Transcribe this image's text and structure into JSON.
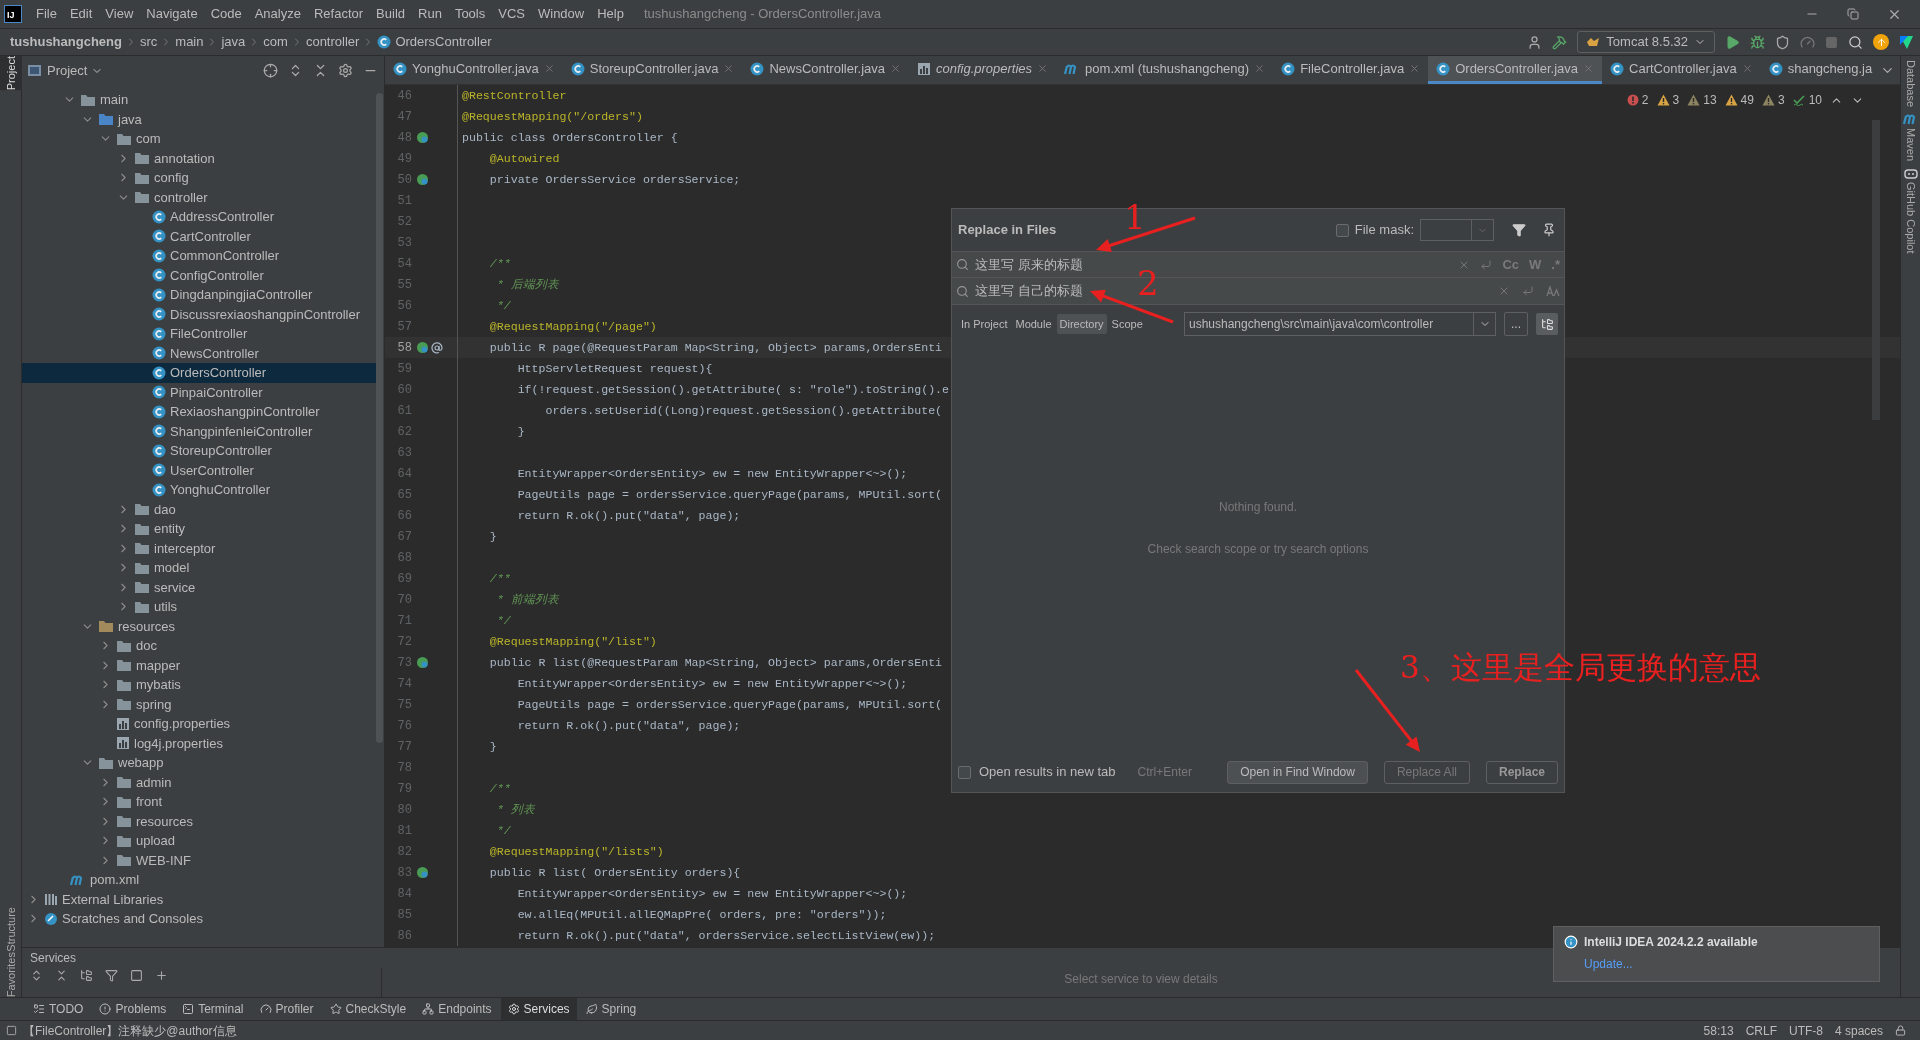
{
  "menu_bar": {
    "logo_text": "IJ",
    "items": [
      "File",
      "Edit",
      "View",
      "Navigate",
      "Code",
      "Analyze",
      "Refactor",
      "Build",
      "Run",
      "Tools",
      "VCS",
      "Window",
      "Help"
    ],
    "title": "tushushangcheng - OrdersController.java"
  },
  "nav_bar": {
    "breadcrumbs": [
      {
        "label": "tushushangcheng",
        "kind": "project"
      },
      {
        "label": "src",
        "kind": "dir"
      },
      {
        "label": "main",
        "kind": "dir"
      },
      {
        "label": "java",
        "kind": "dir"
      },
      {
        "label": "com",
        "kind": "dir"
      },
      {
        "label": "controller",
        "kind": "dir"
      },
      {
        "label": "OrdersController",
        "kind": "class"
      }
    ],
    "run_config": "Tomcat 8.5.32"
  },
  "left_stripe": [
    {
      "label": "Project",
      "selected": true
    },
    {
      "label": "Structure",
      "selected": false
    },
    {
      "label": "Favorites",
      "selected": false
    }
  ],
  "right_stripe": [
    {
      "label": "Database",
      "kind": "database"
    },
    {
      "label": "Maven",
      "kind": "maven"
    },
    {
      "label": "GitHub Copilot",
      "kind": "copilot"
    }
  ],
  "project_panel": {
    "title": "Project",
    "tree": [
      {
        "label": "main",
        "kind": "folder",
        "expanded": true,
        "selected": false,
        "children": [
          {
            "label": "java",
            "kind": "source-folder",
            "expanded": true,
            "selected": false,
            "children": [
              {
                "label": "com",
                "kind": "folder",
                "expanded": true,
                "selected": false,
                "children": [
                  {
                    "label": "annotation",
                    "kind": "folder",
                    "expanded": false,
                    "selected": false
                  },
                  {
                    "label": "config",
                    "kind": "folder",
                    "expanded": false,
                    "selected": false
                  },
                  {
                    "label": "controller",
                    "kind": "folder",
                    "expanded": true,
                    "selected": false,
                    "children": [
                      {
                        "label": "AddressController",
                        "kind": "class",
                        "selected": false
                      },
                      {
                        "label": "CartController",
                        "kind": "class",
                        "selected": false
                      },
                      {
                        "label": "CommonController",
                        "kind": "class",
                        "selected": false
                      },
                      {
                        "label": "ConfigController",
                        "kind": "class",
                        "selected": false
                      },
                      {
                        "label": "DingdanpingjiaController",
                        "kind": "class",
                        "selected": false
                      },
                      {
                        "label": "DiscussrexiaoshangpinController",
                        "kind": "class",
                        "selected": false
                      },
                      {
                        "label": "FileController",
                        "kind": "class",
                        "selected": false
                      },
                      {
                        "label": "NewsController",
                        "kind": "class",
                        "selected": false
                      },
                      {
                        "label": "OrdersController",
                        "kind": "class",
                        "selected": true
                      },
                      {
                        "label": "PinpaiController",
                        "kind": "class",
                        "selected": false
                      },
                      {
                        "label": "RexiaoshangpinController",
                        "kind": "class",
                        "selected": false
                      },
                      {
                        "label": "ShangpinfenleiController",
                        "kind": "class",
                        "selected": false
                      },
                      {
                        "label": "StoreupController",
                        "kind": "class",
                        "selected": false
                      },
                      {
                        "label": "UserController",
                        "kind": "class",
                        "selected": false
                      },
                      {
                        "label": "YonghuController",
                        "kind": "class",
                        "selected": false
                      }
                    ]
                  },
                  {
                    "label": "dao",
                    "kind": "folder",
                    "expanded": false,
                    "selected": false
                  },
                  {
                    "label": "entity",
                    "kind": "folder",
                    "expanded": false,
                    "selected": false
                  },
                  {
                    "label": "interceptor",
                    "kind": "folder",
                    "expanded": false,
                    "selected": false
                  },
                  {
                    "label": "model",
                    "kind": "folder",
                    "expanded": false,
                    "selected": false
                  },
                  {
                    "label": "service",
                    "kind": "folder",
                    "expanded": false,
                    "selected": false
                  },
                  {
                    "label": "utils",
                    "kind": "folder",
                    "expanded": false,
                    "selected": false
                  }
                ]
              }
            ]
          },
          {
            "label": "resources",
            "kind": "resources-folder",
            "expanded": true,
            "selected": false,
            "children": [
              {
                "label": "doc",
                "kind": "folder",
                "expanded": false,
                "selected": false
              },
              {
                "label": "mapper",
                "kind": "folder",
                "expanded": false,
                "selected": false
              },
              {
                "label": "mybatis",
                "kind": "folder",
                "expanded": false,
                "selected": false
              },
              {
                "label": "spring",
                "kind": "folder",
                "expanded": false,
                "selected": false
              },
              {
                "label": "config.properties",
                "kind": "properties",
                "selected": false
              },
              {
                "label": "log4j.properties",
                "kind": "properties",
                "selected": false
              }
            ]
          },
          {
            "label": "webapp",
            "kind": "folder",
            "expanded": true,
            "selected": false,
            "children": [
              {
                "label": "admin",
                "kind": "folder",
                "expanded": false,
                "selected": false
              },
              {
                "label": "front",
                "kind": "folder",
                "expanded": false,
                "selected": false
              },
              {
                "label": "resources",
                "kind": "folder",
                "expanded": false,
                "selected": false
              },
              {
                "label": "upload",
                "kind": "folder",
                "expanded": false,
                "selected": false
              },
              {
                "label": "WEB-INF",
                "kind": "folder",
                "expanded": false,
                "selected": false
              }
            ]
          }
        ]
      },
      {
        "label": "pom.xml",
        "kind": "maven",
        "selected": false
      },
      {
        "label": "External Libraries",
        "kind": "library",
        "expanded": false,
        "selected": false
      },
      {
        "label": "Scratches and Consoles",
        "kind": "scratches",
        "expanded": false,
        "selected": false
      }
    ]
  },
  "editor_tabs": [
    {
      "label": "YonghuController.java",
      "kind": "class",
      "selected": false
    },
    {
      "label": "StoreupController.java",
      "kind": "class",
      "selected": false
    },
    {
      "label": "NewsController.java",
      "kind": "class",
      "selected": false
    },
    {
      "label": "config.properties",
      "kind": "properties",
      "selected": false
    },
    {
      "label": "pom.xml (tushushangcheng)",
      "kind": "maven",
      "selected": false
    },
    {
      "label": "FileController.java",
      "kind": "class",
      "selected": false
    },
    {
      "label": "OrdersController.java",
      "kind": "class",
      "selected": true
    },
    {
      "label": "CartController.java",
      "kind": "class",
      "selected": false
    },
    {
      "label": "shangcheng.ja",
      "kind": "class",
      "selected": false
    }
  ],
  "inspections": [
    {
      "kind": "error",
      "count": "2"
    },
    {
      "kind": "warning",
      "count": "3"
    },
    {
      "kind": "weak",
      "count": "13"
    },
    {
      "kind": "warning",
      "count": "49"
    },
    {
      "kind": "weak",
      "count": "3"
    },
    {
      "kind": "typo",
      "count": "10"
    }
  ],
  "code_lines": [
    {
      "no": "46",
      "kind": "annotation",
      "text": "@RestController",
      "current": false
    },
    {
      "no": "47",
      "kind": "annotation",
      "text": "@RequestMapping(\"/orders\")",
      "current": false
    },
    {
      "no": "48",
      "kind": "code",
      "text": "public class OrdersController {",
      "current": false,
      "gutter_icon": {
        "kind": "bean"
      }
    },
    {
      "no": "49",
      "kind": "annotation",
      "text": "    @Autowired",
      "current": false
    },
    {
      "no": "50",
      "kind": "code",
      "text": "    private OrdersService ordersService;",
      "current": false,
      "gutter_icon": {
        "kind": "bean"
      }
    },
    {
      "no": "51",
      "kind": "blank",
      "current": false
    },
    {
      "no": "52",
      "kind": "blank",
      "current": false
    },
    {
      "no": "53",
      "kind": "blank",
      "current": false
    },
    {
      "no": "54",
      "kind": "comment",
      "text": "    /**",
      "current": false
    },
    {
      "no": "55",
      "kind": "comment",
      "text": "     * 后端列表",
      "current": false
    },
    {
      "no": "56",
      "kind": "comment",
      "text": "     */",
      "current": false
    },
    {
      "no": "57",
      "kind": "annotation",
      "text": "    @RequestMapping(\"/page\")",
      "current": false
    },
    {
      "no": "58",
      "kind": "code",
      "text": "    public R page(@RequestParam Map<String, Object> params,OrdersEnti",
      "current": true,
      "gutter_icon": {
        "kind": "bean-at"
      }
    },
    {
      "no": "59",
      "kind": "code",
      "text": "        HttpServletRequest request){",
      "current": false
    },
    {
      "no": "60",
      "kind": "code",
      "text": "        if(!request.getSession().getAttribute( s: \"role\").toString().e",
      "current": false
    },
    {
      "no": "61",
      "kind": "code",
      "text": "            orders.setUserid((Long)request.getSession().getAttribute(",
      "current": false
    },
    {
      "no": "62",
      "kind": "code",
      "text": "        }",
      "current": false
    },
    {
      "no": "63",
      "kind": "blank",
      "current": false
    },
    {
      "no": "64",
      "kind": "code",
      "text": "        EntityWrapper<OrdersEntity> ew = new EntityWrapper<~>();",
      "current": false
    },
    {
      "no": "65",
      "kind": "code",
      "text": "        PageUtils page = ordersService.queryPage(params, MPUtil.sort(",
      "current": false
    },
    {
      "no": "66",
      "kind": "code",
      "text": "        return R.ok().put(\"data\", page);",
      "current": false
    },
    {
      "no": "67",
      "kind": "code",
      "text": "    }",
      "current": false
    },
    {
      "no": "68",
      "kind": "blank",
      "current": false
    },
    {
      "no": "69",
      "kind": "comment",
      "text": "    /**",
      "current": false
    },
    {
      "no": "70",
      "kind": "comment",
      "text": "     * 前端列表",
      "current": false
    },
    {
      "no": "71",
      "kind": "comment",
      "text": "     */",
      "current": false
    },
    {
      "no": "72",
      "kind": "annotation",
      "text": "    @RequestMapping(\"/list\")",
      "current": false
    },
    {
      "no": "73",
      "kind": "code",
      "text": "    public R list(@RequestParam Map<String, Object> params,OrdersEnti",
      "current": false,
      "gutter_icon": {
        "kind": "bean"
      }
    },
    {
      "no": "74",
      "kind": "code",
      "text": "        EntityWrapper<OrdersEntity> ew = new EntityWrapper<~>();",
      "current": false
    },
    {
      "no": "75",
      "kind": "code",
      "text": "        PageUtils page = ordersService.queryPage(params, MPUtil.sort(",
      "current": false
    },
    {
      "no": "76",
      "kind": "code",
      "text": "        return R.ok().put(\"data\", page);",
      "current": false
    },
    {
      "no": "77",
      "kind": "code",
      "text": "    }",
      "current": false
    },
    {
      "no": "78",
      "kind": "blank",
      "current": false
    },
    {
      "no": "79",
      "kind": "comment",
      "text": "    /**",
      "current": false
    },
    {
      "no": "80",
      "kind": "comment",
      "text": "     * 列表",
      "current": false
    },
    {
      "no": "81",
      "kind": "comment",
      "text": "     */",
      "current": false
    },
    {
      "no": "82",
      "kind": "annotation",
      "text": "    @RequestMapping(\"/lists\")",
      "current": false
    },
    {
      "no": "83",
      "kind": "code",
      "text": "    public R list( OrdersEntity orders){",
      "current": false,
      "gutter_icon": {
        "kind": "bean"
      }
    },
    {
      "no": "84",
      "kind": "code",
      "text": "        EntityWrapper<OrdersEntity> ew = new EntityWrapper<~>();",
      "current": false
    },
    {
      "no": "85",
      "kind": "code",
      "text": "        ew.allEq(MPUtil.allEQMapPre( orders, pre: \"orders\"));",
      "current": false
    },
    {
      "no": "86",
      "kind": "code",
      "text": "        return R.ok().put(\"data\", ordersService.selectListView(ew));",
      "current": false
    }
  ],
  "replace_dialog": {
    "title": "Replace in Files",
    "file_mask": {
      "label": "File mask:",
      "checked": false
    },
    "search_text": "这里写 原来的标题",
    "replace_text": "这里写 自己的标题",
    "search_options": [
      "Cc",
      "W",
      ".*"
    ],
    "scopes": [
      {
        "label": "In Project",
        "selected": false
      },
      {
        "label": "Module",
        "selected": false
      },
      {
        "label": "Directory",
        "selected": true
      },
      {
        "label": "Scope",
        "selected": false
      }
    ],
    "directory": "ushushangcheng\\src\\main\\java\\com\\controller",
    "browse": "...",
    "empty_title": "Nothing found.",
    "empty_hint": "Check search scope or try search options",
    "open_in_new_tab": {
      "label": "Open results in new tab",
      "checked": false
    },
    "shortcut": "Ctrl+Enter",
    "buttons": [
      {
        "label": "Open in Find Window",
        "disabled": false
      },
      {
        "label": "Replace All",
        "disabled": true
      },
      {
        "label": "Replace",
        "disabled": false
      }
    ]
  },
  "annotations": [
    {
      "kind": "number",
      "text": "1"
    },
    {
      "kind": "number",
      "text": "2"
    },
    {
      "kind": "note",
      "text": "3、这里是全局更换的意思"
    }
  ],
  "services": {
    "title": "Services",
    "empty": "Select service to view details"
  },
  "tool_tabs": [
    {
      "label": "TODO",
      "selected": false
    },
    {
      "label": "Problems",
      "selected": false
    },
    {
      "label": "Terminal",
      "selected": false
    },
    {
      "label": "Profiler",
      "selected": false
    },
    {
      "label": "CheckStyle",
      "selected": false
    },
    {
      "label": "Endpoints",
      "selected": false
    },
    {
      "label": "Services",
      "selected": true
    },
    {
      "label": "Spring",
      "selected": false
    }
  ],
  "notification": {
    "title": "IntelliJ IDEA 2024.2.2 available",
    "link": "Update..."
  },
  "status_bar": {
    "message": "【FileController】注释缺少@author信息",
    "position": "58:13",
    "line_sep": "CRLF",
    "encoding": "UTF-8",
    "indent": "4 spaces"
  }
}
